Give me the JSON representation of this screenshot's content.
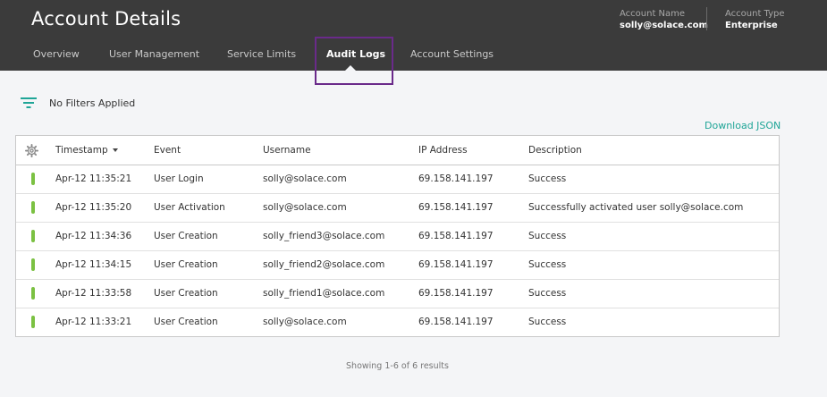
{
  "header": {
    "title": "Account Details",
    "account_name_label": "Account Name",
    "account_name_value": "solly@solace.com",
    "account_type_label": "Account Type",
    "account_type_value": "Enterprise"
  },
  "tabs": [
    {
      "label": "Overview",
      "active": false
    },
    {
      "label": "User Management",
      "active": false
    },
    {
      "label": "Service Limits",
      "active": false
    },
    {
      "label": "Audit Logs",
      "active": true
    },
    {
      "label": "Account Settings",
      "active": false
    }
  ],
  "filters": {
    "icon": "filter-icon",
    "text": "No Filters Applied"
  },
  "download_label": "Download JSON",
  "table": {
    "settings_icon": "gear-icon",
    "columns": [
      "Timestamp",
      "Event",
      "Username",
      "IP Address",
      "Description"
    ],
    "sort_column": "Timestamp",
    "rows": [
      {
        "status": "success",
        "timestamp": "Apr-12 11:35:21",
        "event": "User Login",
        "username": "solly@solace.com",
        "ip": "69.158.141.197",
        "description": "Success"
      },
      {
        "status": "success",
        "timestamp": "Apr-12 11:35:20",
        "event": "User Activation",
        "username": "solly@solace.com",
        "ip": "69.158.141.197",
        "description": "Successfully activated user solly@solace.com"
      },
      {
        "status": "success",
        "timestamp": "Apr-12 11:34:36",
        "event": "User Creation",
        "username": "solly_friend3@solace.com",
        "ip": "69.158.141.197",
        "description": "Success"
      },
      {
        "status": "success",
        "timestamp": "Apr-12 11:34:15",
        "event": "User Creation",
        "username": "solly_friend2@solace.com",
        "ip": "69.158.141.197",
        "description": "Success"
      },
      {
        "status": "success",
        "timestamp": "Apr-12 11:33:58",
        "event": "User Creation",
        "username": "solly_friend1@solace.com",
        "ip": "69.158.141.197",
        "description": "Success"
      },
      {
        "status": "success",
        "timestamp": "Apr-12 11:33:21",
        "event": "User Creation",
        "username": "solly@solace.com",
        "ip": "69.158.141.197",
        "description": "Success"
      }
    ]
  },
  "pagination_text": "Showing 1-6 of 6 results",
  "colors": {
    "header_bg": "#3b3b3b",
    "accent": "#1fa597",
    "status_success": "#7bc142",
    "highlight": "#6a2a8a"
  }
}
